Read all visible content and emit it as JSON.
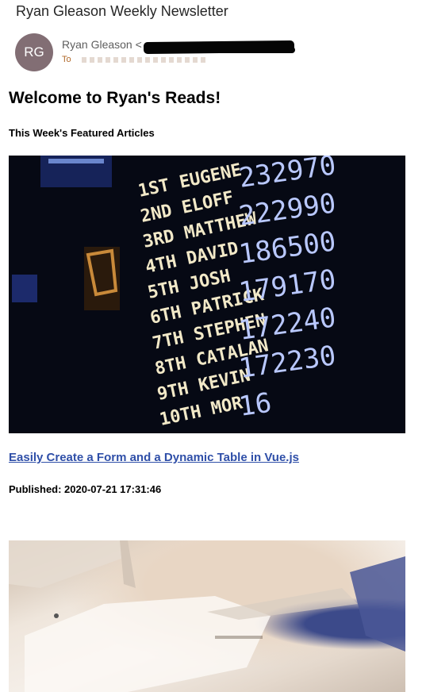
{
  "email": {
    "subject": "Ryan Gleason Weekly Newsletter",
    "avatar_initials": "RG",
    "sender_name": "Ryan Gleason <",
    "to_label": "To"
  },
  "newsletter": {
    "welcome_heading": "Welcome to Ryan's Reads!",
    "section_heading": "This Week's Featured Articles",
    "articles": [
      {
        "title": "Easily Create a Form and a Dynamic Table in Vue.js",
        "published": "Published: 2020-07-21 17:31:46"
      }
    ],
    "leaderboard_image": {
      "names": [
        "1ST EUGENE",
        "2ND ELOFF",
        "3RD MATTHEW",
        "4TH DAVID",
        "5TH JOSH",
        "6TH PATRICK",
        "7TH STEPHEN",
        "8TH CATALAN",
        "9TH KEVIN",
        "10TH MOR"
      ],
      "scores": [
        "232970",
        "222990",
        "186500",
        "179170",
        "172240",
        "172230",
        "16"
      ]
    }
  },
  "colors": {
    "link": "#2f4fa8",
    "avatar_bg": "#826e74",
    "to_label": "#b06a2b"
  }
}
